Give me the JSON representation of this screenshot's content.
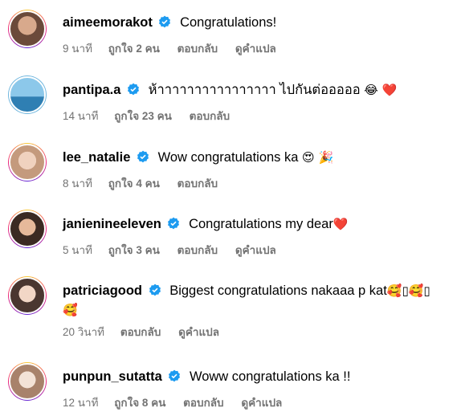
{
  "comments": [
    {
      "username": "aimeemorakot",
      "verified": true,
      "text": "Congratulations!",
      "time": "9 นาที",
      "likes": "ถูกใจ 2 คน",
      "reply": "ตอบกลับ",
      "translate": "ดูคำแปล"
    },
    {
      "username": "pantipa.a",
      "verified": true,
      "text": "ห้าาาาาาาาาาาาาาาา ไปกันต่อออออ",
      "emoji": "😂 ❤️",
      "time": "14 นาที",
      "likes": "ถูกใจ 23 คน",
      "reply": "ตอบกลับ"
    },
    {
      "username": "lee_natalie",
      "verified": true,
      "text": "Wow congratulations ka",
      "emoji": "😍 🎉",
      "time": "8 นาที",
      "likes": "ถูกใจ 4 คน",
      "reply": "ตอบกลับ"
    },
    {
      "username": "janienineeleven",
      "verified": true,
      "text": "Congratulations my dear",
      "emoji": "❤️",
      "time": "5 นาที",
      "likes": "ถูกใจ 3 คน",
      "reply": "ตอบกลับ",
      "translate": "ดูคำแปล"
    },
    {
      "username": "patriciagood",
      "verified": true,
      "text": "Biggest congratulations nakaaa p kat",
      "emoji": "🥰▯🥰▯",
      "emoji_line2": "🥰",
      "time": "20 วินาที",
      "reply": "ตอบกลับ",
      "translate": "ดูคำแปล"
    },
    {
      "username": "punpun_sutatta",
      "verified": true,
      "text": "Woww congratulations ka !!",
      "time": "12 นาที",
      "likes": "ถูกใจ 8 คน",
      "reply": "ตอบกลับ",
      "translate": "ดูคำแปล"
    }
  ],
  "colors": {
    "meta_text": "#737373",
    "verified_badge": "#1d9bf0",
    "story_ring": "#ee2a7b"
  }
}
